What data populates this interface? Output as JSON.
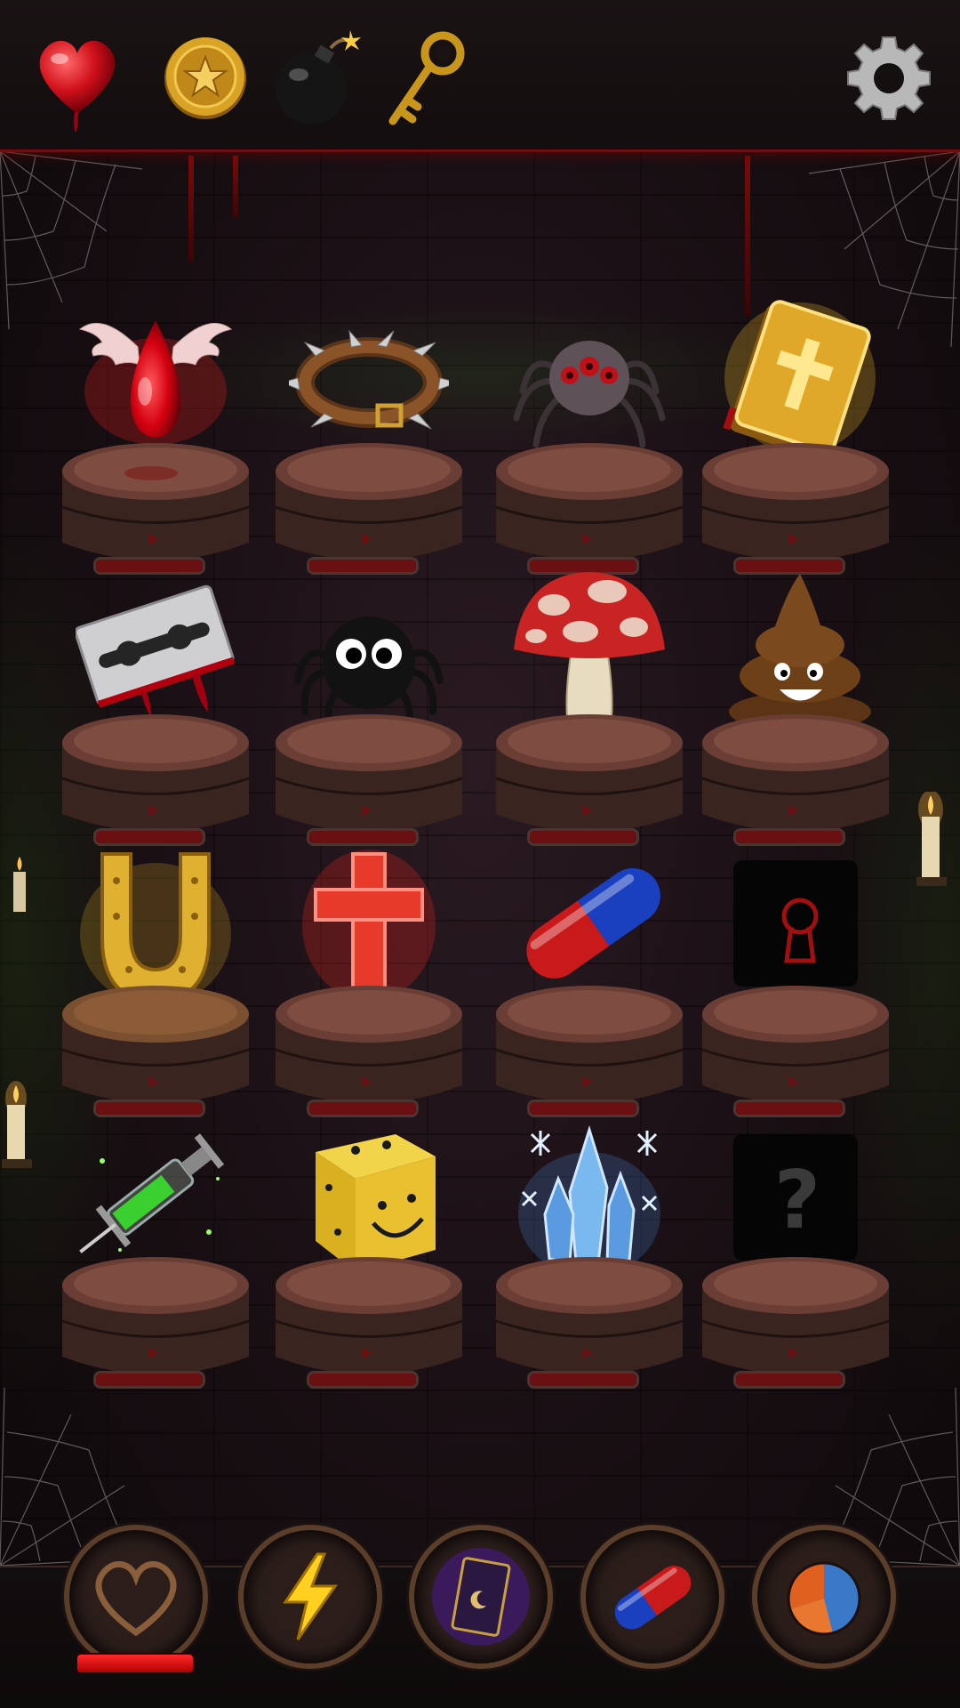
{
  "hud": {
    "icons": [
      "heart-icon",
      "coin-icon",
      "bomb-icon",
      "key-icon"
    ],
    "settings_icon": "gear-icon"
  },
  "items": [
    {
      "name": "blood-drop-wings",
      "row": 1,
      "col": 1,
      "progress": 0.0
    },
    {
      "name": "spiked-collar",
      "row": 1,
      "col": 2,
      "progress": 0.0
    },
    {
      "name": "three-eyed-spider",
      "row": 1,
      "col": 3,
      "progress": 0.0
    },
    {
      "name": "holy-bible",
      "row": 1,
      "col": 4,
      "progress": 0.0
    },
    {
      "name": "bloody-razor-blade",
      "row": 2,
      "col": 1,
      "progress": 0.0
    },
    {
      "name": "cute-black-spider",
      "row": 2,
      "col": 2,
      "progress": 0.0
    },
    {
      "name": "red-spotted-mushroom",
      "row": 2,
      "col": 3,
      "progress": 0.0
    },
    {
      "name": "smiling-poop",
      "row": 2,
      "col": 4,
      "progress": 0.0
    },
    {
      "name": "golden-horseshoe",
      "row": 3,
      "col": 1,
      "progress": 0.0
    },
    {
      "name": "red-cross",
      "row": 3,
      "col": 2,
      "progress": 0.0
    },
    {
      "name": "red-blue-pill",
      "row": 3,
      "col": 3,
      "progress": 0.0
    },
    {
      "name": "locked-slot",
      "row": 3,
      "col": 4,
      "progress": 0.0,
      "locked": true
    },
    {
      "name": "green-syringe",
      "row": 4,
      "col": 1,
      "progress": 0.0
    },
    {
      "name": "smiley-dice",
      "row": 4,
      "col": 2,
      "progress": 0.0
    },
    {
      "name": "ice-crystal",
      "row": 4,
      "col": 3,
      "progress": 0.0
    },
    {
      "name": "mystery-slot",
      "row": 4,
      "col": 4,
      "progress": 0.0,
      "unknown": true
    }
  ],
  "mystery_symbol": "?",
  "bottom": {
    "buttons": [
      "heart-outline-icon",
      "lightning-icon",
      "tarot-card-icon",
      "pill-icon",
      "pie-chart-pill-icon"
    ],
    "health_fill": 1.0
  },
  "colors": {
    "accent_red": "#c4141a",
    "gold": "#e0b030",
    "frame_bronze": "#5a3e2a"
  }
}
